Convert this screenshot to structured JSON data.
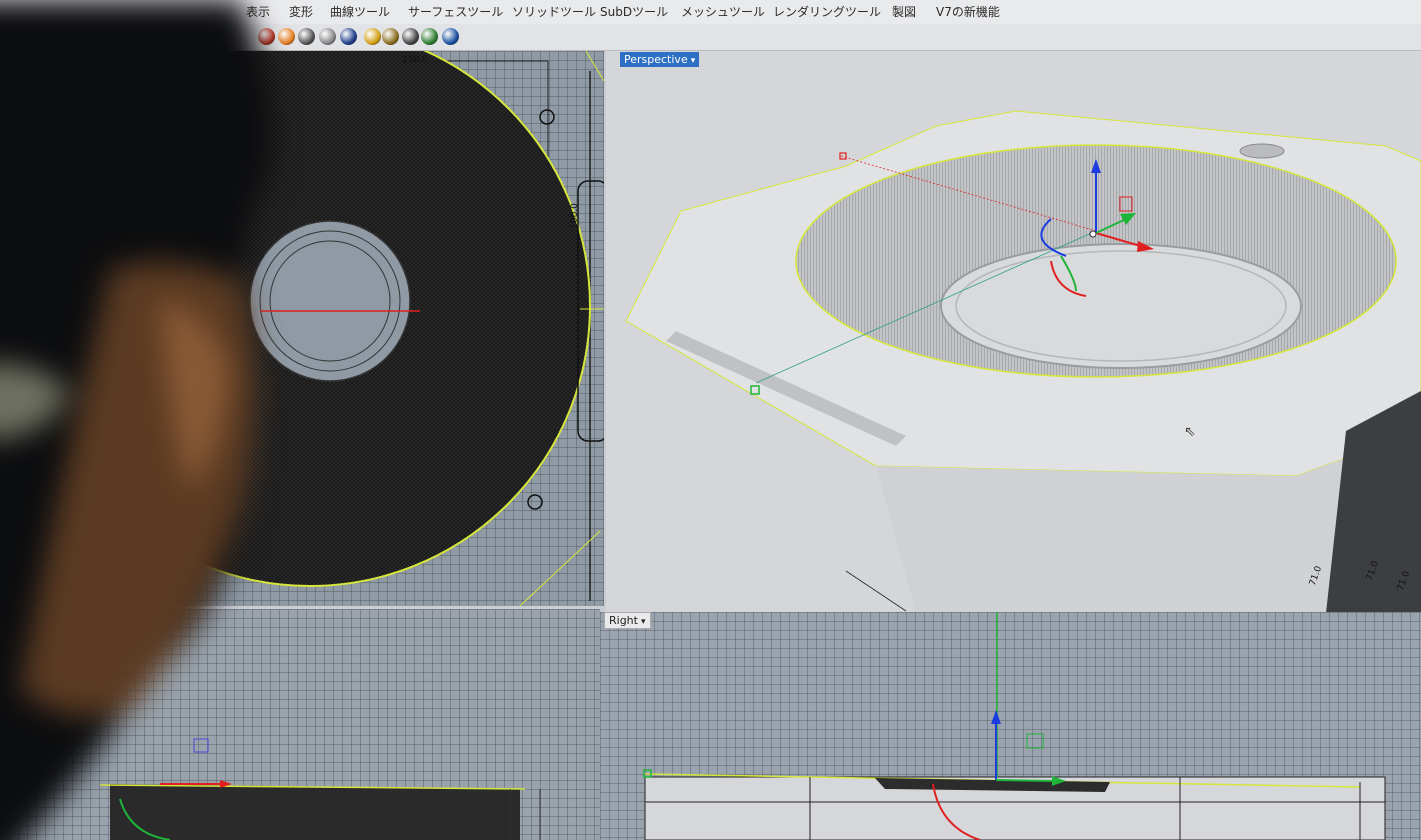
{
  "menu": {
    "items": [
      {
        "label": "表示"
      },
      {
        "label": "変形"
      },
      {
        "label": "曲線ツール"
      },
      {
        "label": "サーフェスツール"
      },
      {
        "label": "ソリッドツール"
      },
      {
        "label": "SubDツール"
      },
      {
        "label": "メッシュツール"
      },
      {
        "label": "レンダリングツール"
      },
      {
        "label": "製図"
      },
      {
        "label": "V7の新機能"
      }
    ]
  },
  "toolbar": {
    "icons": [
      {
        "name": "render-icon",
        "color": "#c0392b"
      },
      {
        "name": "color-wheel-icon",
        "color": "#e67e22"
      },
      {
        "name": "sphere-gray-icon",
        "color": "#555555"
      },
      {
        "name": "sphere-light-icon",
        "color": "#888888"
      },
      {
        "name": "sphere-blue-icon",
        "color": "#1f3f8a"
      },
      {
        "name": "spotlight-icon",
        "color": "#d4a017"
      },
      {
        "name": "gear-icon",
        "color": "#8a6d1f"
      },
      {
        "name": "dimension-icon",
        "color": "#444444"
      },
      {
        "name": "globe-icon",
        "color": "#2e7d32"
      },
      {
        "name": "help-icon",
        "color": "#1a4fa0"
      }
    ]
  },
  "viewports": {
    "top": {
      "dim_width": "150.0",
      "dim_height": "100.0"
    },
    "perspective": {
      "label": "Perspective",
      "dims": [
        "71.0",
        "71.0",
        "71.0"
      ]
    },
    "right": {
      "label": "Right"
    }
  },
  "colors": {
    "selection_outline": "#d7e63a",
    "axis_x": "#e02020",
    "axis_y": "#1fb43a",
    "axis_z": "#1a3ce0",
    "viewport_active_label": "#2d6fc4"
  }
}
